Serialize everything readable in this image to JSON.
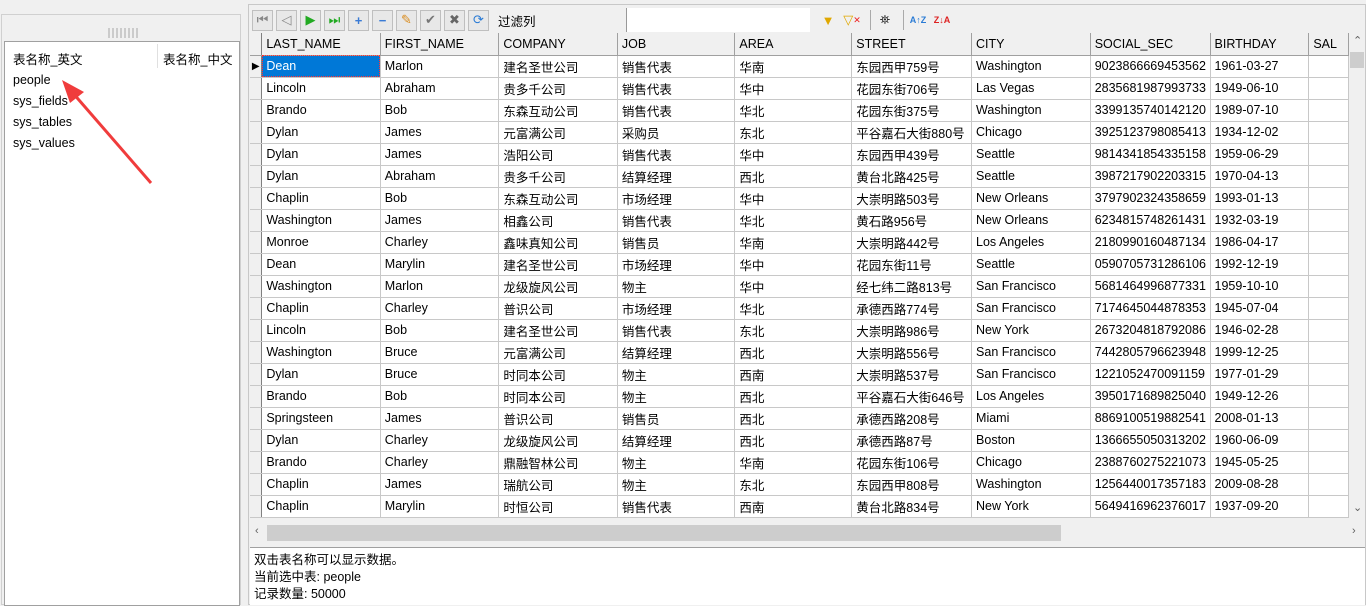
{
  "left_panel": {
    "columns": [
      "表名称_英文",
      "表名称_中文"
    ],
    "tables": [
      "people",
      "sys_fields",
      "sys_tables",
      "sys_values"
    ]
  },
  "toolbar": {
    "filter_label": "过滤列",
    "filter_value": "",
    "icons": [
      "first-record-icon",
      "prev-record-icon",
      "next-record-icon",
      "last-record-icon",
      "add-record-icon",
      "delete-record-icon",
      "edit-record-icon",
      "post-record-icon",
      "cancel-record-icon",
      "refresh-icon"
    ],
    "right_icons": [
      "filter-icon",
      "clear-filter-icon",
      "find-icon",
      "sort-ascending-icon",
      "sort-descending-icon"
    ]
  },
  "grid": {
    "columns": [
      "LAST_NAME",
      "FIRST_NAME",
      "COMPANY",
      "JOB",
      "AREA",
      "STREET",
      "CITY",
      "SOCIAL_SEC",
      "BIRTHDAY",
      "SAL"
    ],
    "rows": [
      [
        "Dean",
        "Marlon",
        "建名圣世公司",
        "销售代表",
        "华南",
        "东园西甲759号",
        "Washington",
        "9023866669453562",
        "1961-03-27",
        ""
      ],
      [
        "Lincoln",
        "Abraham",
        "贵多千公司",
        "销售代表",
        "华中",
        "花园东街706号",
        "Las Vegas",
        "2835681987993733",
        "1949-06-10",
        ""
      ],
      [
        "Brando",
        "Bob",
        "东森互动公司",
        "销售代表",
        "华北",
        "花园东街375号",
        "Washington",
        "3399135740142120",
        "1989-07-10",
        ""
      ],
      [
        "Dylan",
        "James",
        "元富满公司",
        "采购员",
        "东北",
        "平谷嘉石大街880号",
        "Chicago",
        "3925123798085413",
        "1934-12-02",
        ""
      ],
      [
        "Dylan",
        "James",
        "浩阳公司",
        "销售代表",
        "华中",
        "东园西甲439号",
        "Seattle",
        "9814341854335158",
        "1959-06-29",
        ""
      ],
      [
        "Dylan",
        "Abraham",
        "贵多千公司",
        "结算经理",
        "西北",
        "黄台北路425号",
        "Seattle",
        "3987217902203315",
        "1970-04-13",
        ""
      ],
      [
        "Chaplin",
        "Bob",
        "东森互动公司",
        "市场经理",
        "华中",
        "大崇明路503号",
        "New Orleans",
        "3797902324358659",
        "1993-01-13",
        ""
      ],
      [
        "Washington",
        "James",
        "相鑫公司",
        "销售代表",
        "华北",
        "黄石路956号",
        "New Orleans",
        "6234815748261431",
        "1932-03-19",
        ""
      ],
      [
        "Monroe",
        "Charley",
        "鑫味真知公司",
        "销售员",
        "华南",
        "大崇明路442号",
        "Los Angeles",
        "2180990160487134",
        "1986-04-17",
        ""
      ],
      [
        "Dean",
        "Marylin",
        "建名圣世公司",
        "市场经理",
        "华中",
        "花园东街11号",
        "Seattle",
        "0590705731286106",
        "1992-12-19",
        ""
      ],
      [
        "Washington",
        "Marlon",
        "龙级旋风公司",
        "物主",
        "华中",
        "经七纬二路813号",
        "San Francisco",
        "5681464996877331",
        "1959-10-10",
        ""
      ],
      [
        "Chaplin",
        "Charley",
        "普识公司",
        "市场经理",
        "华北",
        "承德西路774号",
        "San Francisco",
        "7174645044878353",
        "1945-07-04",
        ""
      ],
      [
        "Lincoln",
        "Bob",
        "建名圣世公司",
        "销售代表",
        "东北",
        "大崇明路986号",
        "New York",
        "2673204818792086",
        "1946-02-28",
        ""
      ],
      [
        "Washington",
        "Bruce",
        "元富满公司",
        "结算经理",
        "西北",
        "大崇明路556号",
        "San Francisco",
        "7442805796623948",
        "1999-12-25",
        ""
      ],
      [
        "Dylan",
        "Bruce",
        "时同本公司",
        "物主",
        "西南",
        "大崇明路537号",
        "San Francisco",
        "1221052470091159",
        "1977-01-29",
        ""
      ],
      [
        "Brando",
        "Bob",
        "时同本公司",
        "物主",
        "西北",
        "平谷嘉石大街646号",
        "Los Angeles",
        "3950171689825040",
        "1949-12-26",
        ""
      ],
      [
        "Springsteen",
        "James",
        "普识公司",
        "销售员",
        "西北",
        "承德西路208号",
        "Miami",
        "8869100519882541",
        "2008-01-13",
        ""
      ],
      [
        "Dylan",
        "Charley",
        "龙级旋风公司",
        "结算经理",
        "西北",
        "承德西路87号",
        "Boston",
        "1366655050313202",
        "1960-06-09",
        ""
      ],
      [
        "Brando",
        "Charley",
        "鼎融智林公司",
        "物主",
        "华南",
        "花园东街106号",
        "Chicago",
        "2388760275221073",
        "1945-05-25",
        ""
      ],
      [
        "Chaplin",
        "James",
        "瑞航公司",
        "物主",
        "东北",
        "东园西甲808号",
        "Washington",
        "1256440017357183",
        "2009-08-28",
        ""
      ],
      [
        "Chaplin",
        "Marylin",
        "时恒公司",
        "销售代表",
        "西南",
        "黄台北路834号",
        "New York",
        "5649416962376017",
        "1937-09-20",
        ""
      ]
    ]
  },
  "status": {
    "hint": "双击表名称可以显示数据。",
    "current_table": "当前选中表: people",
    "record_count": "记录数量: 50000"
  },
  "colors": {
    "selection": "#0078d7",
    "annotation_arrow": "#f03c3c"
  }
}
